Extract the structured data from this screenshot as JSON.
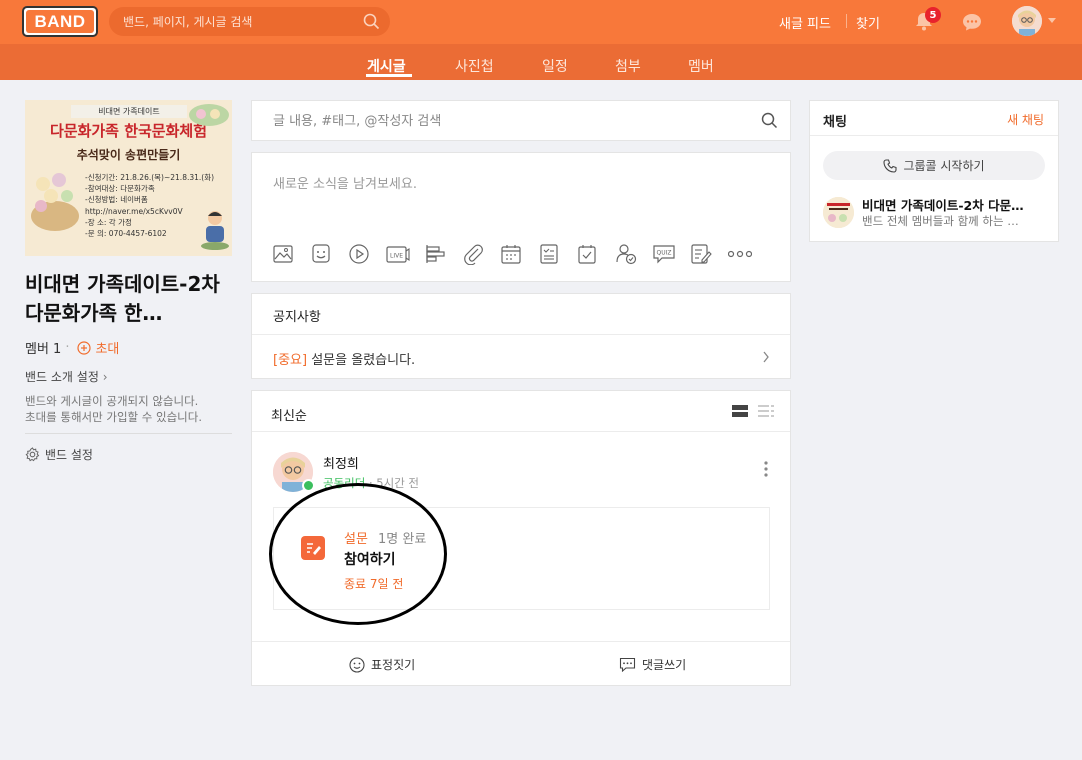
{
  "header": {
    "logo": "BAND",
    "search_placeholder": "밴드, 페이지, 게시글 검색",
    "new_feed": "새글 피드",
    "find": "찾기",
    "notification_count": "5"
  },
  "tabs": [
    {
      "label": "게시글",
      "active": true
    },
    {
      "label": "사진첩",
      "active": false
    },
    {
      "label": "일정",
      "active": false
    },
    {
      "label": "첨부",
      "active": false
    },
    {
      "label": "멤버",
      "active": false
    }
  ],
  "cover": {
    "line1": "비대면 가족데이트",
    "line2": "다문화가족 한국문화체험",
    "line3": "추석맞이 송편만들기",
    "details": [
      "-신청기간: 21.8.26.(목)~21.8.31.(화)",
      "-참여대상: 다문화가족",
      "-신청방법: 네이버폼",
      "http://naver.me/x5cKvv0V",
      "-장     소: 각 가정",
      "-문     의: 070-4457-6102"
    ]
  },
  "band": {
    "name": "비대면 가족데이트-2차 다문화가족 한…",
    "members": "멤버 1",
    "invite": "초대",
    "intro_setting": "밴드 소개 설정",
    "description_line1": "밴드와 게시글이 공개되지 않습니다.",
    "description_line2": "초대를 통해서만 가입할 수 있습니다.",
    "settings": "밴드 설정"
  },
  "post_search": {
    "placeholder": "글 내용, #태그, @작성자 검색"
  },
  "write": {
    "placeholder": "새로운 소식을 남겨보세요."
  },
  "notice": {
    "title": "공지사항",
    "important": "[중요]",
    "text": "설문을 올렸습니다."
  },
  "feed": {
    "sort": "최신순",
    "post": {
      "author": "최정희",
      "role": "공동리더",
      "time": "5시간 전",
      "survey_label": "설문",
      "survey_count": "1명 완료",
      "survey_title": "참여하기",
      "survey_end": "종료 7일 전"
    },
    "actions": {
      "emotion": "표정짓기",
      "comment": "댓글쓰기"
    }
  },
  "chat": {
    "title": "채팅",
    "new_chat": "새 채팅",
    "group_call": "그룹콜 시작하기",
    "room_name": "비대면 가족데이트-2차 다문…",
    "room_sub": "밴드 전체 멤버들과 함께 하는 …"
  },
  "colors": {
    "brand": "#f8783a",
    "accent": "#f16c2c",
    "online": "#3bbf5e"
  }
}
